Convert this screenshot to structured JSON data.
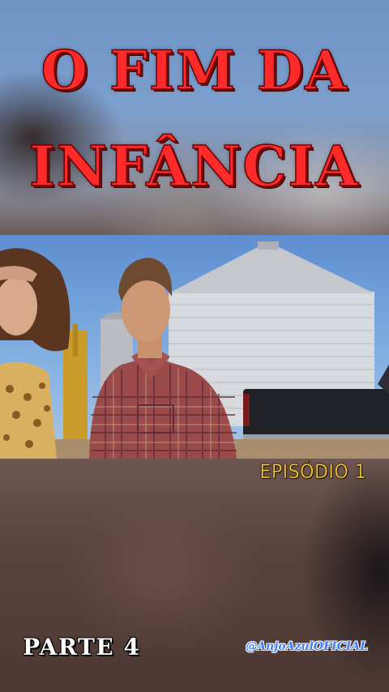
{
  "title": {
    "line1": "O FIM DA",
    "line2": "INFÂNCIA"
  },
  "video": {
    "scene_description_icon": "video-frame",
    "colors": {
      "title_red": "#ff2a2a",
      "episode_yellow": "#ffd23a",
      "handle_blue": "#3f7cff"
    }
  },
  "episode_label": "EPISÓDIO 1",
  "part_label": "PARTE 4",
  "channel_handle": "@AnjoAzulOFICIAL"
}
